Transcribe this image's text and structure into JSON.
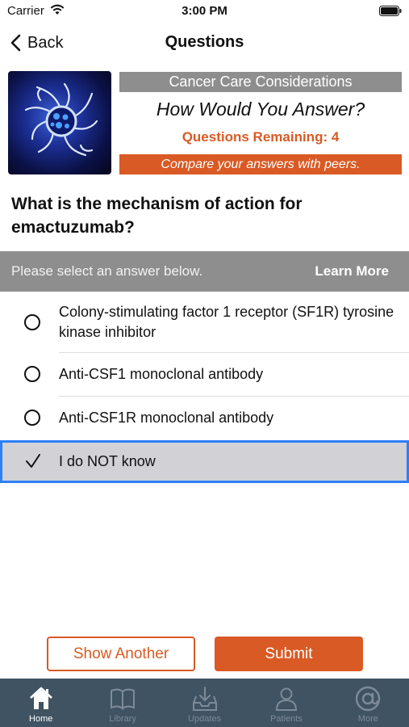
{
  "status_bar": {
    "carrier": "Carrier",
    "time": "3:00 PM"
  },
  "nav": {
    "back_label": "Back",
    "title": "Questions"
  },
  "banner": {
    "series": "Cancer Care Considerations",
    "headline": "How Would You Answer?",
    "remaining": "Questions Remaining: 4",
    "cta": "Compare your answers with peers.",
    "image_icon": "cancer-cell-illustration"
  },
  "question": {
    "text": "What is the mechanism of action for emactuzumab?"
  },
  "answer_bar": {
    "prompt": "Please select an answer below.",
    "learn_more": "Learn More"
  },
  "answers": [
    {
      "label": "Colony-stimulating factor 1 receptor (SF1R) tyrosine kinase inhibitor",
      "selected": false
    },
    {
      "label": "Anti-CSF1 monoclonal antibody",
      "selected": false
    },
    {
      "label": "Anti-CSF1R monoclonal antibody",
      "selected": false
    },
    {
      "label": "I do NOT know",
      "selected": true
    }
  ],
  "buttons": {
    "show_another": "Show Another",
    "submit": "Submit"
  },
  "tabs": [
    {
      "label": "Home",
      "icon": "home-icon",
      "active": true
    },
    {
      "label": "Library",
      "icon": "book-icon",
      "active": false
    },
    {
      "label": "Updates",
      "icon": "inbox-download-icon",
      "active": false
    },
    {
      "label": "Patients",
      "icon": "person-icon",
      "active": false
    },
    {
      "label": "More",
      "icon": "at-sign-icon",
      "active": false
    }
  ],
  "colors": {
    "accent": "#d95a24",
    "gray_bar": "#8e8e8e",
    "selected_row": "#d1d1d6",
    "selected_border": "#2d7ff9",
    "tab_bar": "#3f5363"
  }
}
